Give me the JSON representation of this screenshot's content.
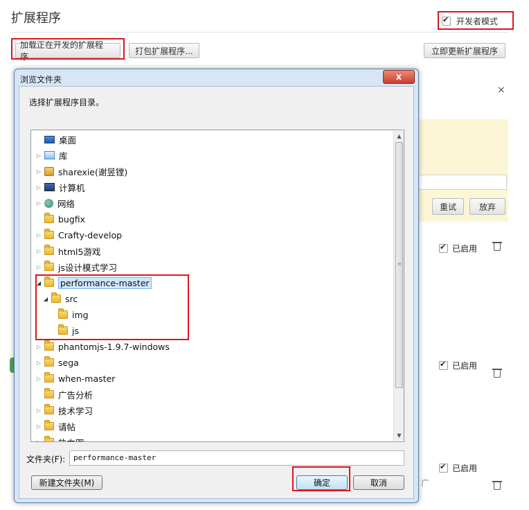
{
  "page": {
    "title": "扩展程序",
    "dev_mode_label": "开发者模式",
    "load_unpacked_label": "加载正在开发的扩展程序...",
    "pack_label": "打包扩展程序...",
    "update_label": "立即更新扩展程序",
    "retry_label": "重试",
    "abandon_label": "放弃",
    "close_glyph": "×",
    "extensions": [
      {
        "enabled_label": "已启用"
      },
      {
        "enabled_label": "已启用"
      },
      {
        "enabled_label": "已启用"
      }
    ],
    "partial_text": "广"
  },
  "dialog": {
    "title": "浏览文件夹",
    "close_glyph": "x",
    "prompt": "选择扩展程序目录。",
    "tree": [
      {
        "label": "桌面",
        "icon": "desktop-icon",
        "expander": ""
      },
      {
        "label": "库",
        "icon": "library-icon",
        "expander": "▷"
      },
      {
        "label": "sharexie(谢昱镗)",
        "icon": "user-folder-icon",
        "expander": "▷"
      },
      {
        "label": "计算机",
        "icon": "computer-icon",
        "expander": "▷"
      },
      {
        "label": "网络",
        "icon": "network-icon",
        "expander": "▷"
      },
      {
        "label": "bugfix",
        "icon": "folder-icon",
        "expander": ""
      },
      {
        "label": "Crafty-develop",
        "icon": "folder-icon",
        "expander": "▷"
      },
      {
        "label": "html5游戏",
        "icon": "folder-icon",
        "expander": "▷"
      },
      {
        "label": "js设计模式学习",
        "icon": "folder-icon",
        "expander": "▷"
      },
      {
        "label": "performance-master",
        "icon": "folder-icon",
        "expander": "◢"
      },
      {
        "label": "src",
        "icon": "folder-icon",
        "expander": "◢"
      },
      {
        "label": "img",
        "icon": "folder-icon",
        "expander": ""
      },
      {
        "label": "js",
        "icon": "folder-icon",
        "expander": ""
      },
      {
        "label": "phantomjs-1.9.7-windows",
        "icon": "folder-icon",
        "expander": "▷"
      },
      {
        "label": "sega",
        "icon": "folder-icon",
        "expander": "▷"
      },
      {
        "label": "when-master",
        "icon": "folder-icon",
        "expander": "▷"
      },
      {
        "label": "广告分析",
        "icon": "folder-icon",
        "expander": ""
      },
      {
        "label": "技术学习",
        "icon": "folder-icon",
        "expander": "▷"
      },
      {
        "label": "请帖",
        "icon": "folder-icon",
        "expander": "▷"
      },
      {
        "label": "热力图",
        "icon": "folder-icon",
        "expander": "▷"
      }
    ],
    "selected_index": 9,
    "folder_label": "文件夹(F):",
    "folder_value": "performance-master",
    "new_folder_label": "新建文件夹(M)",
    "ok_label": "确定",
    "cancel_label": "取消",
    "scroll_up_glyph": "▲",
    "scroll_down_glyph": "▼"
  },
  "colors": {
    "highlight_frame": "#e0141b",
    "dialog_frame": "#d6e6f7",
    "selection": "#cde8ff"
  }
}
